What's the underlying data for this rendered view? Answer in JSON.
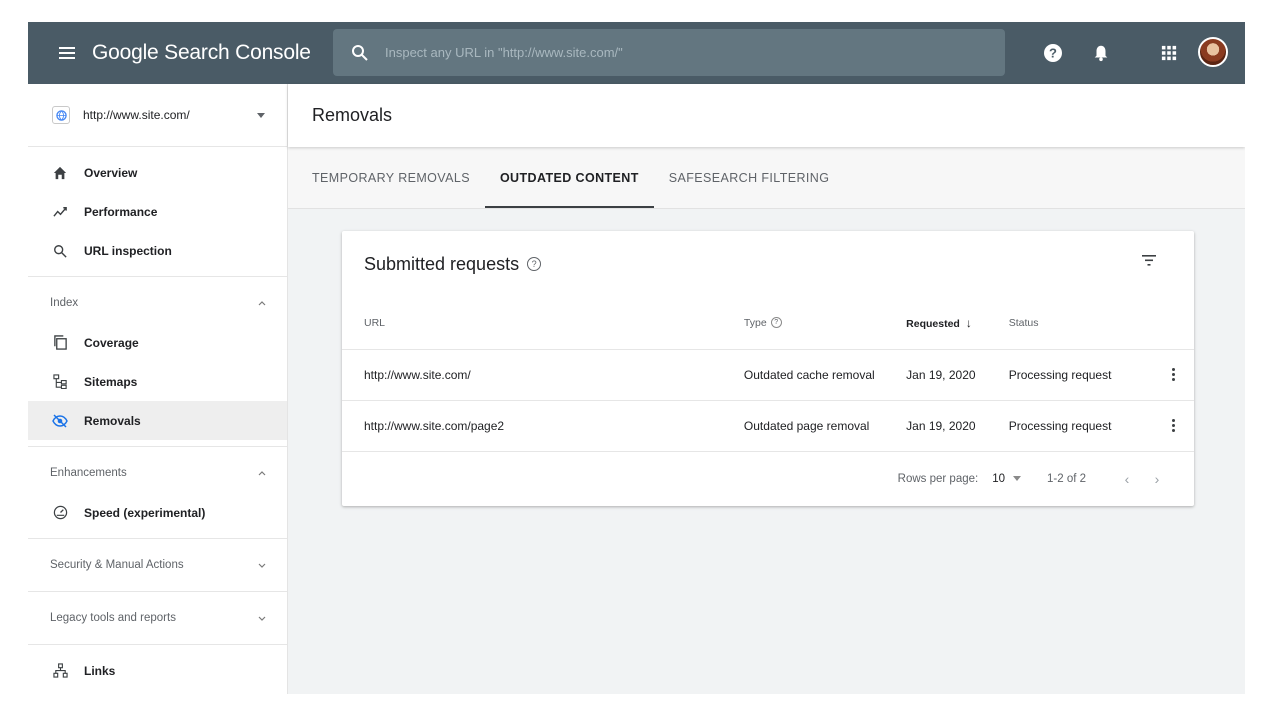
{
  "app": {
    "brand": "Google Search Console",
    "search_placeholder": "Inspect any URL in \"http://www.site.com/\""
  },
  "topbar_icons": [
    "menu-icon",
    "search-icon",
    "help-icon",
    "bell-icon",
    "apps-grid-icon",
    "avatar"
  ],
  "sidebar": {
    "property": "http://www.site.com/",
    "primary_items": [
      {
        "label": "Overview",
        "icon": "home-icon"
      },
      {
        "label": "Performance",
        "icon": "trend-icon"
      },
      {
        "label": "URL inspection",
        "icon": "search-icon"
      }
    ],
    "index": {
      "header": "Index",
      "items": [
        {
          "label": "Coverage",
          "icon": "coverage-icon"
        },
        {
          "label": "Sitemaps",
          "icon": "sitemap-icon"
        },
        {
          "label": "Removals",
          "icon": "removals-icon",
          "active": true
        }
      ]
    },
    "enhancements": {
      "header": "Enhancements",
      "items": [
        {
          "label": "Speed (experimental)",
          "icon": "speed-icon"
        }
      ]
    },
    "security": {
      "header": "Security & Manual Actions"
    },
    "legacy": {
      "header": "Legacy tools and reports"
    },
    "links": {
      "label": "Links",
      "icon": "links-icon"
    }
  },
  "main": {
    "title": "Removals",
    "tabs": [
      {
        "label": "TEMPORARY REMOVALS",
        "active": false
      },
      {
        "label": "OUTDATED CONTENT",
        "active": true
      },
      {
        "label": "SAFESEARCH FILTERING",
        "active": false
      }
    ],
    "card": {
      "title": "Submitted requests",
      "help_glyph": "?",
      "columns": {
        "url": "URL",
        "type": "Type",
        "requested": "Requested",
        "status": "Status"
      },
      "rows": [
        {
          "url": "http://www.site.com/",
          "type": "Outdated cache removal",
          "requested": "Jan 19, 2020",
          "status": "Processing request"
        },
        {
          "url": "http://www.site.com/page2",
          "type": "Outdated page removal",
          "requested": "Jan 19, 2020",
          "status": "Processing request"
        }
      ],
      "pagination": {
        "rows_label": "Rows per page:",
        "rows_value": "10",
        "range": "1-2 of 2",
        "prev": "‹",
        "next": "›"
      },
      "sort_arrow": "↓"
    }
  },
  "colors": {
    "topbar": "#4a5b66",
    "search": "#637680",
    "main_bg": "#f1f3f4",
    "active_nav": "#eeeeee"
  }
}
